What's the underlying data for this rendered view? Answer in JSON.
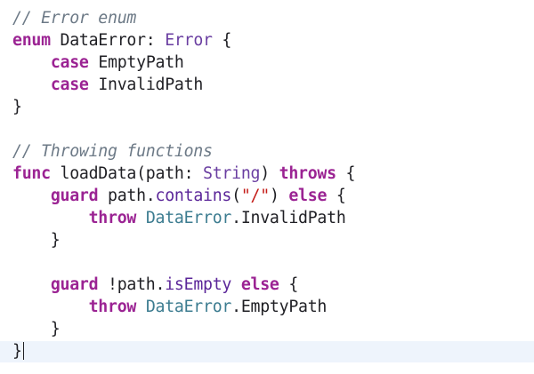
{
  "editor": {
    "lines": [
      [
        {
          "t": "// Error enum",
          "c": "comment"
        }
      ],
      [
        {
          "t": "enum",
          "c": "keyword"
        },
        {
          "t": " DataError: ",
          "c": "plain"
        },
        {
          "t": "Error",
          "c": "type"
        },
        {
          "t": " {",
          "c": "plain"
        }
      ],
      [
        {
          "t": "    ",
          "c": "plain"
        },
        {
          "t": "case",
          "c": "keyword"
        },
        {
          "t": " EmptyPath",
          "c": "plain"
        }
      ],
      [
        {
          "t": "    ",
          "c": "plain"
        },
        {
          "t": "case",
          "c": "keyword"
        },
        {
          "t": " InvalidPath",
          "c": "plain"
        }
      ],
      [
        {
          "t": "}",
          "c": "plain"
        }
      ],
      [],
      [
        {
          "t": "// Throwing functions",
          "c": "comment"
        }
      ],
      [
        {
          "t": "func",
          "c": "keyword"
        },
        {
          "t": " loadData(path: ",
          "c": "plain"
        },
        {
          "t": "String",
          "c": "type"
        },
        {
          "t": ") ",
          "c": "plain"
        },
        {
          "t": "throws",
          "c": "keyword"
        },
        {
          "t": " {",
          "c": "plain"
        }
      ],
      [
        {
          "t": "    ",
          "c": "plain"
        },
        {
          "t": "guard",
          "c": "keyword"
        },
        {
          "t": " path.",
          "c": "plain"
        },
        {
          "t": "contains",
          "c": "func"
        },
        {
          "t": "(",
          "c": "plain"
        },
        {
          "t": "\"/\"",
          "c": "string"
        },
        {
          "t": ") ",
          "c": "plain"
        },
        {
          "t": "else",
          "c": "keyword"
        },
        {
          "t": " {",
          "c": "plain"
        }
      ],
      [
        {
          "t": "        ",
          "c": "plain"
        },
        {
          "t": "throw",
          "c": "keyword"
        },
        {
          "t": " ",
          "c": "plain"
        },
        {
          "t": "DataError",
          "c": "typeref"
        },
        {
          "t": ".InvalidPath",
          "c": "plain"
        }
      ],
      [
        {
          "t": "    }",
          "c": "plain"
        }
      ],
      [],
      [
        {
          "t": "    ",
          "c": "plain"
        },
        {
          "t": "guard",
          "c": "keyword"
        },
        {
          "t": " !path.",
          "c": "plain"
        },
        {
          "t": "isEmpty",
          "c": "func"
        },
        {
          "t": " ",
          "c": "plain"
        },
        {
          "t": "else",
          "c": "keyword"
        },
        {
          "t": " {",
          "c": "plain"
        }
      ],
      [
        {
          "t": "        ",
          "c": "plain"
        },
        {
          "t": "throw",
          "c": "keyword"
        },
        {
          "t": " ",
          "c": "plain"
        },
        {
          "t": "DataError",
          "c": "typeref"
        },
        {
          "t": ".EmptyPath",
          "c": "plain"
        }
      ],
      [
        {
          "t": "    }",
          "c": "plain"
        }
      ],
      [
        {
          "t": "}",
          "c": "plain"
        }
      ]
    ],
    "current_line": 15
  }
}
